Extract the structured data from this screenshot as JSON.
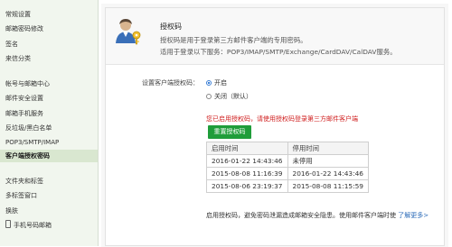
{
  "sidebar": {
    "items": [
      {
        "label": "常规设置",
        "active": false
      },
      {
        "label": "邮箱密码修改",
        "active": false
      },
      {
        "label": "签名",
        "active": false
      },
      {
        "label": "来信分类",
        "active": false
      },
      {
        "label": "帐号与邮箱中心",
        "active": false
      },
      {
        "label": "邮件安全设置",
        "active": false
      },
      {
        "label": "邮箱手机服务",
        "active": false
      },
      {
        "label": "反垃圾/黑白名单",
        "active": false
      },
      {
        "label": "POP3/SMTP/IMAP",
        "active": false
      },
      {
        "label": "客户端授权密码",
        "active": true
      },
      {
        "label": "文件夹和标签",
        "active": false
      },
      {
        "label": "多标签窗口",
        "active": false
      },
      {
        "label": "换肤",
        "active": false
      },
      {
        "label": "手机号码邮箱",
        "active": false
      }
    ]
  },
  "header": {
    "title": "授权码",
    "desc1": "授权码是用于登录第三方邮件客户端的专用密码。",
    "desc2": "适用于登录以下服务：POP3/IMAP/SMTP/Exchange/CardDAV/CalDAV服务。"
  },
  "setting": {
    "label": "设置客户端授权码：",
    "option_on": "开启",
    "option_off": "关闭（默认）",
    "selected": "on"
  },
  "warning": "您已启用授权码，请使用授权码登录第三方邮件客户端",
  "reset_button": "重置授权码",
  "table": {
    "headers": [
      "启用时间",
      "停用时间"
    ],
    "rows": [
      [
        "2016-01-22 14:43:46",
        "未停用"
      ],
      [
        "2015-08-08 11:16:39",
        "2016-01-22 14:43:46"
      ],
      [
        "2015-08-06 23:19:37",
        "2015-08-08 11:15:59"
      ]
    ]
  },
  "footer": {
    "text": "启用授权码，避免密码泄漏造成邮箱安全隐患。使用邮件客户端时使",
    "link": "了解更多>"
  },
  "colors": {
    "sidebar_bg": "#f1f6ee",
    "active_bg": "#d9e7d0",
    "button_green": "#1f9d3a",
    "warning_red": "#d02020",
    "link_blue": "#2a6ab8"
  }
}
